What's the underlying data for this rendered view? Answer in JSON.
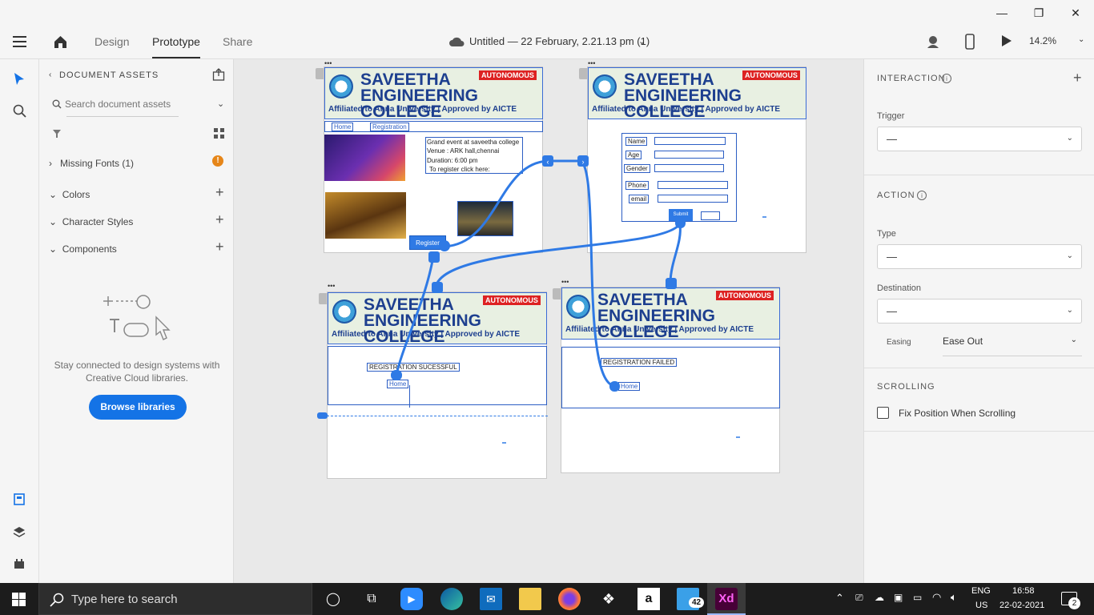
{
  "titlebar": {
    "minimize": "—",
    "restore": "❐",
    "close": "✕"
  },
  "toolbar": {
    "tabs": [
      "Design",
      "Prototype",
      "Share"
    ],
    "doc_title": "Untitled — 22 February, 2.21.13 pm (1)",
    "zoom": "14.2%"
  },
  "assets": {
    "header": "DOCUMENT ASSETS",
    "search_placeholder": "Search document assets",
    "missing_fonts": "Missing Fonts (1)",
    "colors": "Colors",
    "character_styles": "Character Styles",
    "components": "Components",
    "cc_message": "Stay connected to design systems with Creative Cloud libraries.",
    "browse_button": "Browse libraries"
  },
  "artboards": {
    "college_top": "SAVEETHA",
    "college_bottom": "ENGINEERING COLLEGE",
    "affiliation": "Affiliated to Anna University | Approved by AICTE",
    "autonomous": "AUTONOMOUS",
    "home": "Home",
    "registration": "Registration",
    "event_line1": "Grand event at saveetha college",
    "event_line2": "Venue : ARK hall,chennai",
    "event_line3": "Duration: 6:00 pm",
    "event_line4": "To register click here:",
    "register_btn": "Register",
    "form_labels": [
      "Name",
      "Age",
      "Gender",
      "Phone",
      "email"
    ],
    "submit_btn": "Submit",
    "success_text": "REGISTRATION SUCESSFUL",
    "failed_text": "REGISTRATION FAILED"
  },
  "right_panel": {
    "interaction_head": "INTERACTION",
    "trigger_label": "Trigger",
    "trigger_value": "—",
    "action_head": "ACTION",
    "type_label": "Type",
    "type_value": "—",
    "destination_label": "Destination",
    "destination_value": "—",
    "easing_label": "Easing",
    "easing_value": "Ease Out",
    "scrolling_head": "SCROLLING",
    "fix_position": "Fix Position When Scrolling"
  },
  "taskbar": {
    "search_placeholder": "Type here to search",
    "lang_top": "ENG",
    "lang_bottom": "US",
    "time": "16:58",
    "date": "22-02-2021",
    "notif_count": "2",
    "badge_42": "42"
  },
  "colors": {
    "accent": "#1473e6",
    "flow": "#2f7ae5",
    "taskbar": "#1c1c1c"
  }
}
